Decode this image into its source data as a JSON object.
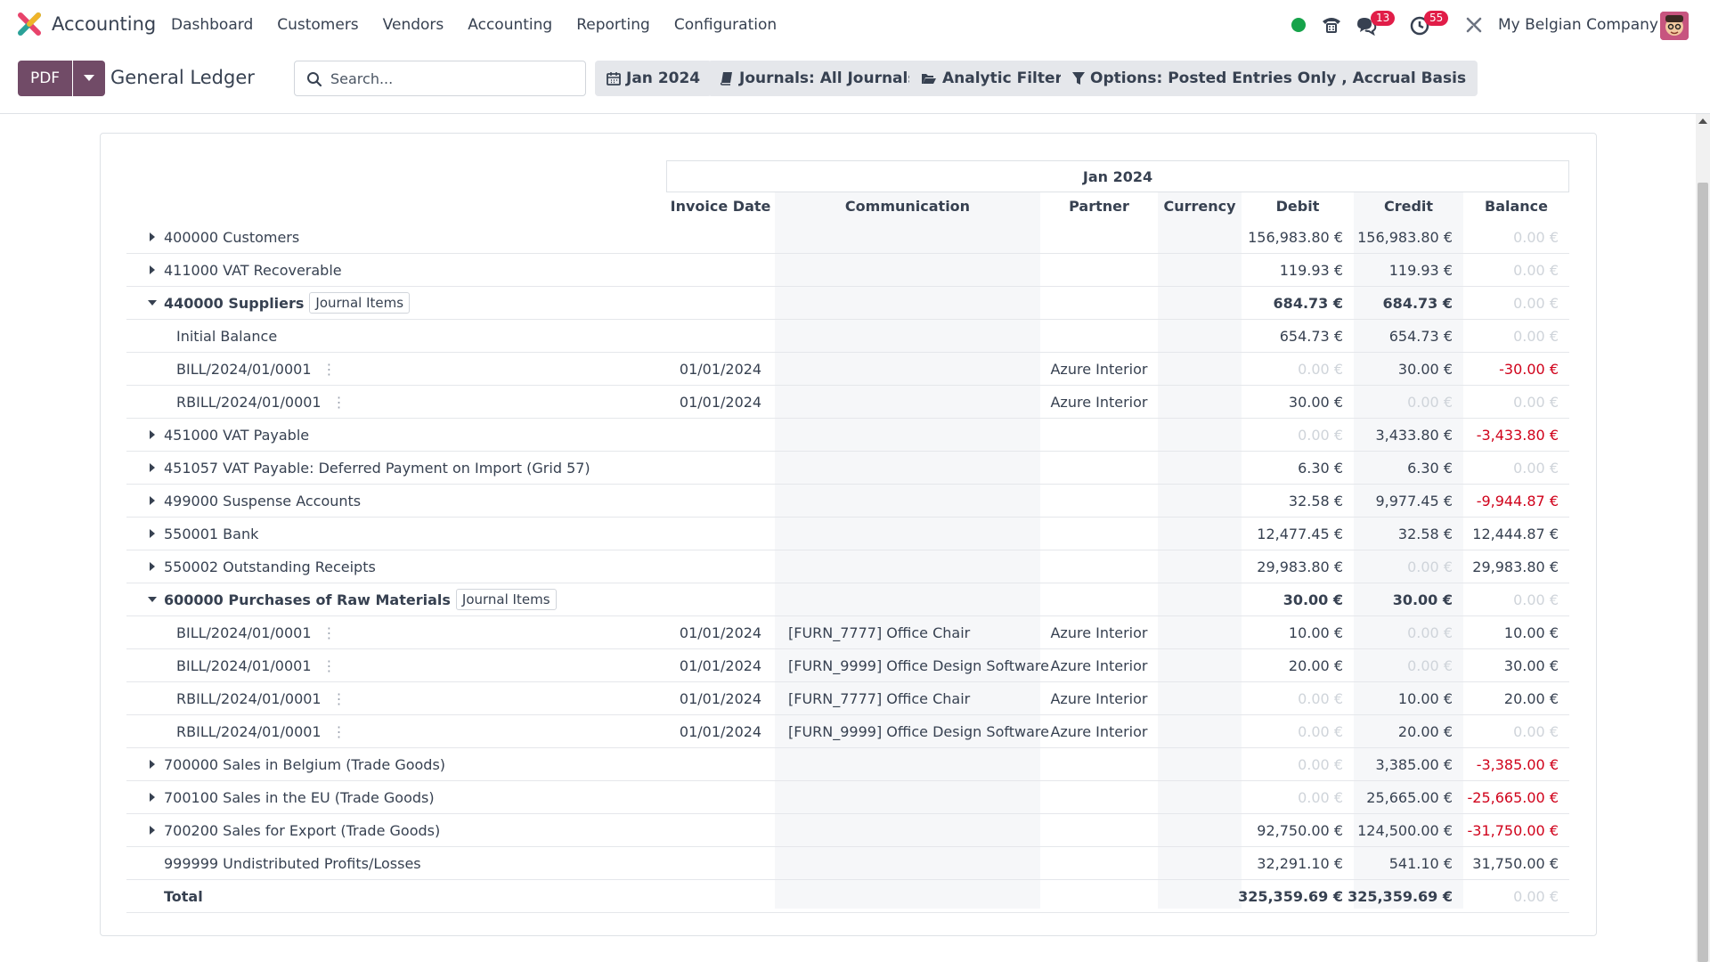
{
  "app": {
    "name": "Accounting"
  },
  "menu": [
    "Dashboard",
    "Customers",
    "Vendors",
    "Accounting",
    "Reporting",
    "Configuration"
  ],
  "systray": {
    "messages_count": "13",
    "activities_count": "55",
    "company": "My Belgian Company"
  },
  "toolbar": {
    "pdf_label": "PDF",
    "title": "General Ledger",
    "search_placeholder": "Search...",
    "date_filter": "Jan 2024",
    "journals_filter": "Journals: All Journals",
    "analytic_filter": "Analytic Filter",
    "options_filter": "Options: Posted Entries Only , Accrual Basis"
  },
  "report": {
    "period": "Jan 2024",
    "columns": [
      "Invoice Date",
      "Communication",
      "Partner",
      "Currency",
      "Debit",
      "Credit",
      "Balance"
    ],
    "rows": [
      {
        "kind": "account",
        "expanded": false,
        "name": "400000 Customers",
        "debit": "156,983.80 €",
        "credit": "156,983.80 €",
        "balance": "0.00 €"
      },
      {
        "kind": "account",
        "expanded": false,
        "name": "411000 VAT Recoverable",
        "debit": "119.93 €",
        "credit": "119.93 €",
        "balance": "0.00 €"
      },
      {
        "kind": "account",
        "expanded": true,
        "name": "440000 Suppliers",
        "tag": "Journal Items",
        "debit": "684.73 €",
        "credit": "684.73 €",
        "balance": "0.00 €"
      },
      {
        "kind": "initial",
        "name": "Initial Balance",
        "debit": "654.73 €",
        "credit": "654.73 €",
        "balance": "0.00 €"
      },
      {
        "kind": "line",
        "name": "BILL/2024/01/0001",
        "date": "01/01/2024",
        "communication": "",
        "partner": "Azure Interior",
        "debit": "0.00 €",
        "credit": "30.00 €",
        "balance": "-30.00 €"
      },
      {
        "kind": "line",
        "name": "RBILL/2024/01/0001",
        "date": "01/01/2024",
        "communication": "",
        "partner": "Azure Interior",
        "debit": "30.00 €",
        "credit": "0.00 €",
        "balance": "0.00 €"
      },
      {
        "kind": "account",
        "expanded": false,
        "name": "451000 VAT Payable",
        "debit": "0.00 €",
        "credit": "3,433.80 €",
        "balance": "-3,433.80 €"
      },
      {
        "kind": "account",
        "expanded": false,
        "name": "451057 VAT Payable: Deferred Payment on Import (Grid 57)",
        "debit": "6.30 €",
        "credit": "6.30 €",
        "balance": "0.00 €"
      },
      {
        "kind": "account",
        "expanded": false,
        "name": "499000 Suspense Accounts",
        "debit": "32.58 €",
        "credit": "9,977.45 €",
        "balance": "-9,944.87 €"
      },
      {
        "kind": "account",
        "expanded": false,
        "name": "550001 Bank",
        "debit": "12,477.45 €",
        "credit": "32.58 €",
        "balance": "12,444.87 €"
      },
      {
        "kind": "account",
        "expanded": false,
        "name": "550002 Outstanding Receipts",
        "debit": "29,983.80 €",
        "credit": "0.00 €",
        "balance": "29,983.80 €"
      },
      {
        "kind": "account",
        "expanded": true,
        "name": "600000 Purchases of Raw Materials",
        "tag": "Journal Items",
        "debit": "30.00 €",
        "credit": "30.00 €",
        "balance": "0.00 €"
      },
      {
        "kind": "line",
        "name": "BILL/2024/01/0001",
        "date": "01/01/2024",
        "communication": "[FURN_7777] Office Chair",
        "partner": "Azure Interior",
        "debit": "10.00 €",
        "credit": "0.00 €",
        "balance": "10.00 €"
      },
      {
        "kind": "line",
        "name": "BILL/2024/01/0001",
        "date": "01/01/2024",
        "communication": "[FURN_9999] Office Design Software",
        "partner": "Azure Interior",
        "debit": "20.00 €",
        "credit": "0.00 €",
        "balance": "30.00 €"
      },
      {
        "kind": "line",
        "name": "RBILL/2024/01/0001",
        "date": "01/01/2024",
        "communication": "[FURN_7777] Office Chair",
        "partner": "Azure Interior",
        "debit": "0.00 €",
        "credit": "10.00 €",
        "balance": "20.00 €"
      },
      {
        "kind": "line",
        "name": "RBILL/2024/01/0001",
        "date": "01/01/2024",
        "communication": "[FURN_9999] Office Design Software",
        "partner": "Azure Interior",
        "debit": "0.00 €",
        "credit": "20.00 €",
        "balance": "0.00 €"
      },
      {
        "kind": "account",
        "expanded": false,
        "name": "700000 Sales in Belgium (Trade Goods)",
        "debit": "0.00 €",
        "credit": "3,385.00 €",
        "balance": "-3,385.00 €"
      },
      {
        "kind": "account",
        "expanded": false,
        "name": "700100 Sales in the EU (Trade Goods)",
        "debit": "0.00 €",
        "credit": "25,665.00 €",
        "balance": "-25,665.00 €"
      },
      {
        "kind": "account",
        "expanded": false,
        "name": "700200 Sales for Export (Trade Goods)",
        "debit": "92,750.00 €",
        "credit": "124,500.00 €",
        "balance": "-31,750.00 €"
      },
      {
        "kind": "plain",
        "name": "999999 Undistributed Profits/Losses",
        "debit": "32,291.10 €",
        "credit": "541.10 €",
        "balance": "31,750.00 €"
      },
      {
        "kind": "total",
        "name": "Total",
        "debit": "325,359.69 €",
        "credit": "325,359.69 €",
        "balance": "0.00 €"
      }
    ]
  },
  "colors": {
    "brand": "#714b67",
    "negative": "#d0021b",
    "online": "#16a34a"
  }
}
